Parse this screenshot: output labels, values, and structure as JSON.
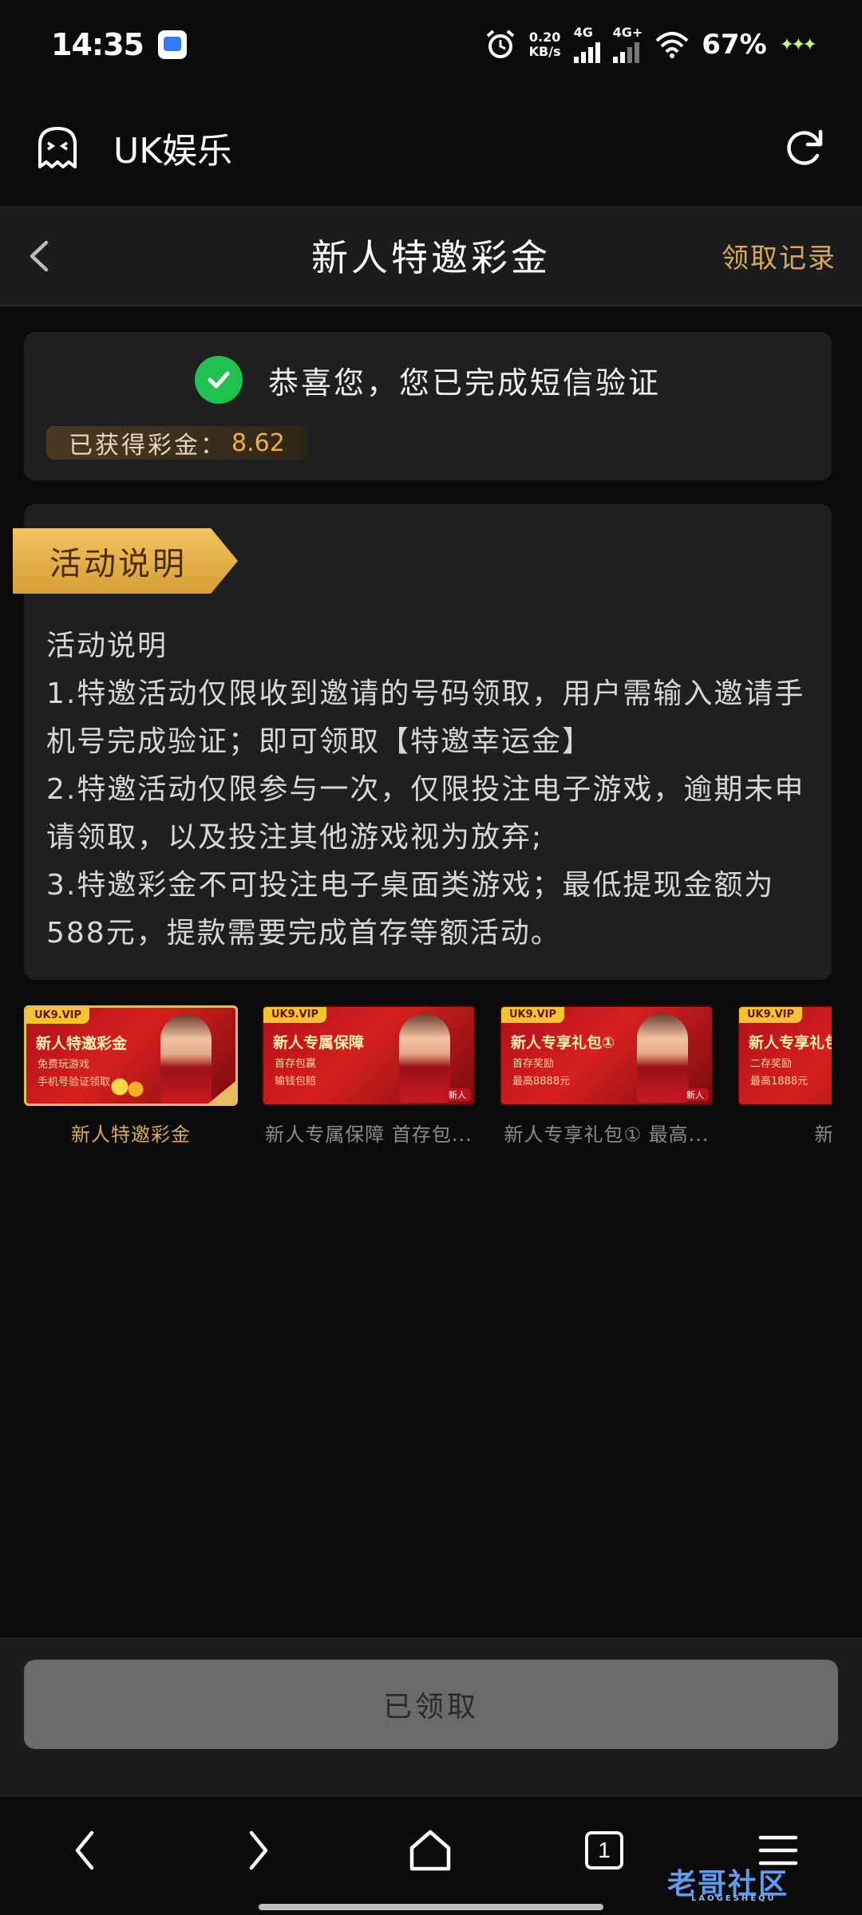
{
  "status_bar": {
    "time": "14:35",
    "speed_value": "0.20",
    "speed_unit": "KB/s",
    "network_1": "4G",
    "network_2": "4G+",
    "battery": "67%"
  },
  "app_header": {
    "title": "UK娱乐",
    "icons": [
      "ghost-logo-icon",
      "refresh-icon"
    ]
  },
  "page_nav": {
    "title": "新人特邀彩金",
    "record_link": "领取记录"
  },
  "success_card": {
    "message": "恭喜您，您已完成短信验证",
    "bonus_label": "已获得彩金：",
    "bonus_value": "8.62"
  },
  "description": {
    "ribbon": "活动说明",
    "heading": "活动说明",
    "rule_1": "1.特邀活动仅限收到邀请的号码领取，用户需输入邀请手机号完成验证；即可领取【特邀幸运金】",
    "rule_2": "2.特邀活动仅限参与一次，仅限投注电子游戏，逾期未申请领取，以及投注其他游戏视为放弃;",
    "rule_3": "3.特邀彩金不可投注电子桌面类游戏；最低提现金额为588元，提款需要完成首存等额活动。"
  },
  "promos": [
    {
      "tag": "UK9.VIP",
      "headline": "新人特邀彩金",
      "sub1": "免费玩游戏",
      "sub2": "手机号验证领取",
      "label": "新人特邀彩金",
      "active": true
    },
    {
      "tag": "UK9.VIP",
      "headline": "新人专属保障",
      "sub1": "首存包赢",
      "sub2": "输钱包赔",
      "badge": "新人",
      "label": "新人专属保障 首存包...",
      "active": false
    },
    {
      "tag": "UK9.VIP",
      "headline": "新人专享礼包①",
      "sub1": "首存奖励",
      "sub2": "最高8888元",
      "badge": "新人",
      "label": "新人专享礼包① 最高...",
      "active": false
    },
    {
      "tag": "UK9.VIP",
      "headline": "新人专享礼包",
      "sub1": "二存奖励",
      "sub2": "最高1888元",
      "label": "新人专",
      "active": false
    }
  ],
  "action": {
    "button_label": "已领取"
  },
  "browser_bar": {
    "tab_count": "1",
    "watermark": "老哥社区",
    "watermark_sub": "LAOGESHEQU"
  },
  "colors": {
    "accent_gold": "#d6aa5a",
    "bonus_orange": "#f0b23c",
    "success_green": "#1fc24e",
    "card_bg": "#1f1f21",
    "page_bg": "#0b0b0b"
  }
}
